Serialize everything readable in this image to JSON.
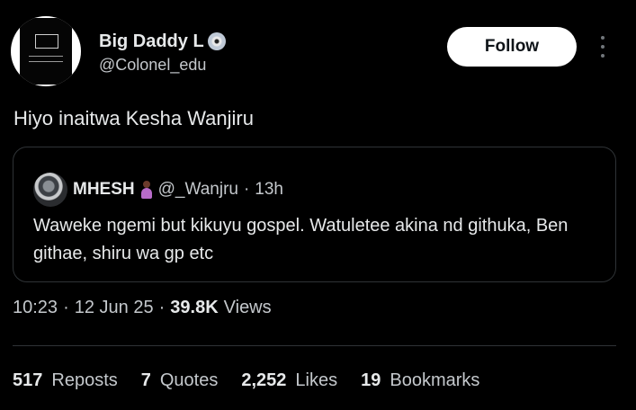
{
  "author": {
    "display_name": "Big Daddy L",
    "display_name_icon": "cd-icon",
    "handle": "@Colonel_edu",
    "avatar_icon": "profile-avatar"
  },
  "follow_label": "Follow",
  "more_icon": "more-vertical-icon",
  "tweet_text": "Hiyo inaitwa Kesha Wanjiru",
  "quote": {
    "name": "MHESH",
    "emoji_icon": "person-emoji",
    "handle": "@_Wanjru",
    "separator": "·",
    "time": "13h",
    "text": "Waweke ngemi but kikuyu gospel. Watuletee akina nd githuka, Ben githae, shiru wa gp etc"
  },
  "meta": {
    "time": "10:23",
    "sep1": "·",
    "date": "12 Jun 25",
    "sep2": "·",
    "views_count": "39.8K",
    "views_label": "Views"
  },
  "stats": [
    {
      "count": "517",
      "label": "Reposts"
    },
    {
      "count": "7",
      "label": "Quotes"
    },
    {
      "count": "2,252",
      "label": "Likes"
    },
    {
      "count": "19",
      "label": "Bookmarks"
    }
  ],
  "colors": {
    "background": "#000000",
    "text_primary": "#e7e9ea",
    "text_secondary": "#c4c8cc",
    "border": "#2f3336",
    "button_bg": "#ffffff"
  }
}
